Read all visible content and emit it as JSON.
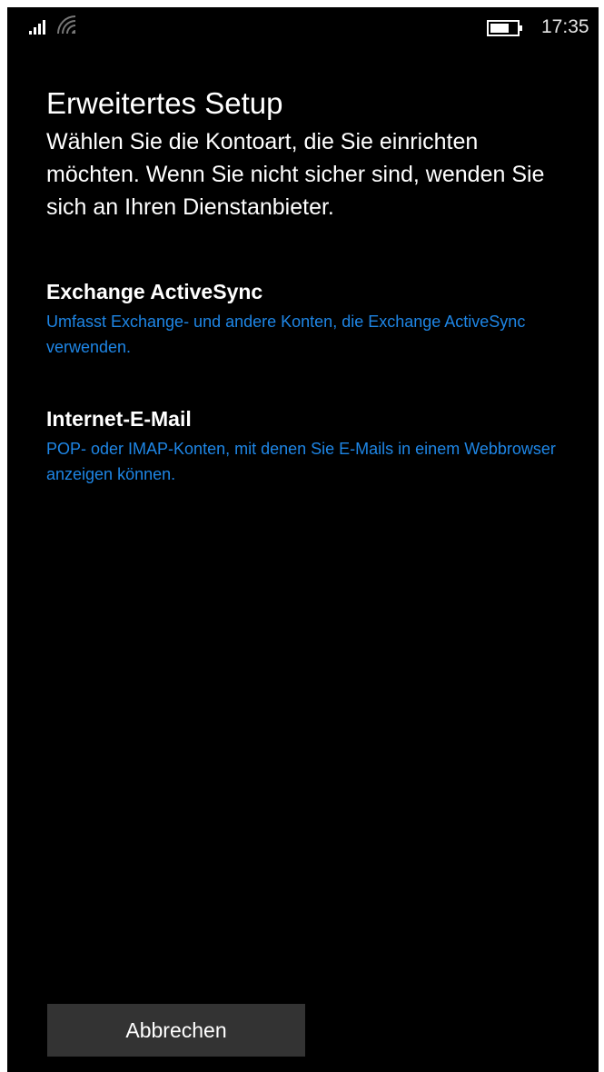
{
  "status_bar": {
    "time": "17:35",
    "signal_icon": "cellular-signal-icon",
    "wifi_icon": "wifi-icon",
    "battery_icon": "battery-icon"
  },
  "header": {
    "title": "Erweitertes Setup",
    "description": "Wählen Sie die Kontoart, die Sie einrichten möchten. Wenn Sie nicht sicher sind, wenden Sie sich an Ihren Dienstanbieter."
  },
  "options": [
    {
      "title": "Exchange ActiveSync",
      "subtitle": "Umfasst Exchange- und andere Konten, die Exchange ActiveSync verwenden."
    },
    {
      "title": "Internet-E-Mail",
      "subtitle": "POP- oder IMAP-Konten, mit denen Sie E-Mails in einem Webbrowser anzeigen können."
    }
  ],
  "footer": {
    "cancel_label": "Abbrechen"
  },
  "colors": {
    "background": "#000000",
    "accent": "#1e86e6",
    "button": "#333333",
    "text": "#ffffff"
  }
}
